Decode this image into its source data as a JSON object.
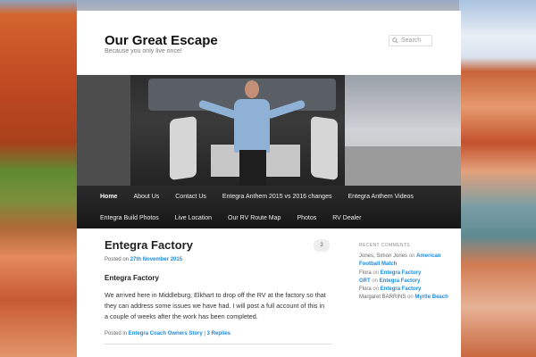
{
  "site": {
    "title": "Our Great Escape",
    "description": "Because you only live once!"
  },
  "search": {
    "placeholder": "Search"
  },
  "nav": {
    "row1": [
      {
        "label": "Home",
        "active": true
      },
      {
        "label": "About Us"
      },
      {
        "label": "Contact Us"
      },
      {
        "label": "Entegra Anthem 2015 vs 2016 changes"
      },
      {
        "label": "Entegra Anthem Videos"
      }
    ],
    "row2": [
      {
        "label": "Entegra Build Photos"
      },
      {
        "label": "Live Location"
      },
      {
        "label": "Our RV Route Map"
      },
      {
        "label": "Photos"
      },
      {
        "label": "RV Dealer"
      }
    ]
  },
  "post": {
    "title": "Entegra Factory",
    "posted_on_label": "Posted on",
    "date": "27th November 2015",
    "comment_count": "3",
    "subtitle": "Entegra Factory",
    "body": "We arrived here in Middleburg, Elkhart to drop off the RV at the factory so that they can address some issues we have had. I will post a full account of this in a couple of weeks after the work has been completed.",
    "posted_in_label": "Posted in",
    "category": "Entegra Coach Owners Story",
    "separator": "|",
    "replies": "3 Replies"
  },
  "sidebar": {
    "recent_comments_title": "RECENT COMMENTS",
    "comments": [
      {
        "author": "Jones, Simon Jones",
        "author_link": false,
        "on": "on",
        "post": "American Football Match"
      },
      {
        "author": "Flora",
        "author_link": false,
        "on": "on",
        "post": "Entegra Factory"
      },
      {
        "author": "GRT",
        "author_link": true,
        "on": "on",
        "post": "Entegra Factory"
      },
      {
        "author": "Flora",
        "author_link": false,
        "on": "on",
        "post": "Entegra Factory"
      },
      {
        "author": "Margaret BARRINS",
        "author_link": false,
        "on": "on",
        "post": "Myrtle Beach"
      }
    ]
  },
  "colors": {
    "link": "#1b8be0",
    "nav_bg": "#1f1f1f",
    "page_bg": "#ffffff"
  }
}
